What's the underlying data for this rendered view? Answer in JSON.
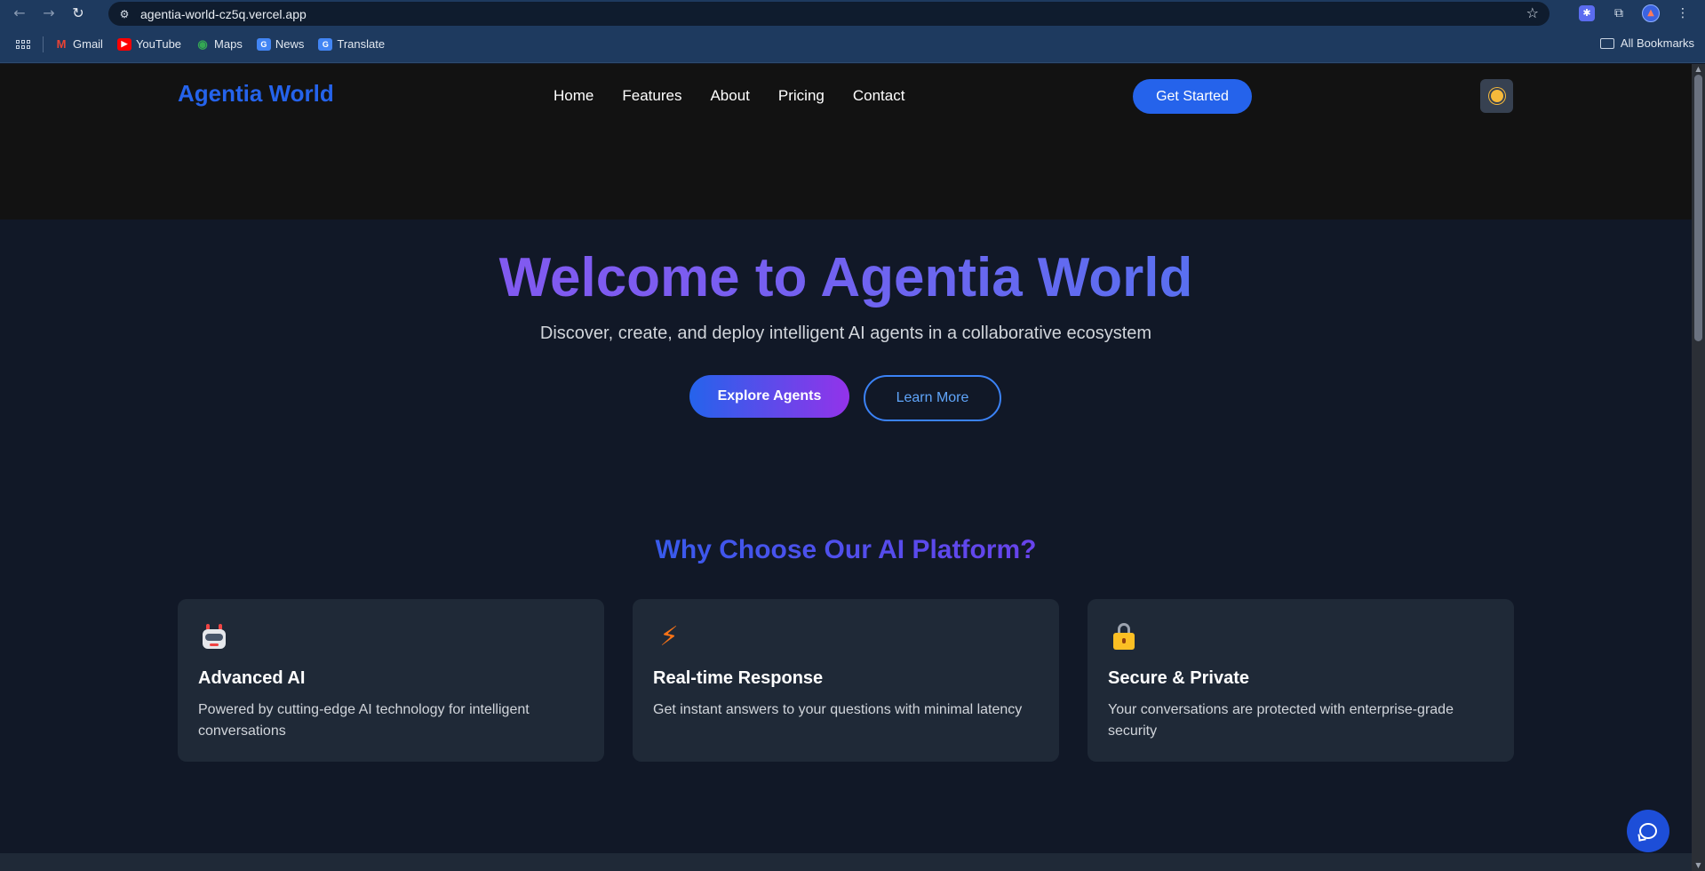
{
  "browser": {
    "url": "agentia-world-cz5q.vercel.app",
    "bookmarks": [
      {
        "label": "Gmail",
        "icon": "gmail-icon",
        "color": "#ea4335"
      },
      {
        "label": "YouTube",
        "icon": "youtube-icon",
        "color": "#ff0000"
      },
      {
        "label": "Maps",
        "icon": "maps-icon",
        "color": "#34a853"
      },
      {
        "label": "News",
        "icon": "news-icon",
        "color": "#4285f4"
      },
      {
        "label": "Translate",
        "icon": "translate-icon",
        "color": "#4285f4"
      }
    ],
    "all_bookmarks": "All Bookmarks"
  },
  "header": {
    "logo": "Agentia World",
    "nav": [
      "Home",
      "Features",
      "About",
      "Pricing",
      "Contact"
    ],
    "cta": "Get Started"
  },
  "hero": {
    "title": "Welcome to Agentia World",
    "subtitle": "Discover, create, and deploy intelligent AI agents in a collaborative ecosystem",
    "primary_button": "Explore Agents",
    "secondary_button": "Learn More"
  },
  "features": {
    "title": "Why Choose Our AI Platform?",
    "cards": [
      {
        "icon": "robot-icon",
        "title": "Advanced AI",
        "text": "Powered by cutting-edge AI technology for intelligent conversations"
      },
      {
        "icon": "lightning-icon",
        "title": "Real-time Response",
        "text": "Get instant answers to your questions with minimal latency"
      },
      {
        "icon": "lock-icon",
        "title": "Secure & Private",
        "text": "Your conversations are protected with enterprise-grade security"
      }
    ]
  },
  "colors": {
    "accent": "#2563eb",
    "purple": "#9333ea",
    "background": "#111827",
    "card": "#1f2937"
  }
}
